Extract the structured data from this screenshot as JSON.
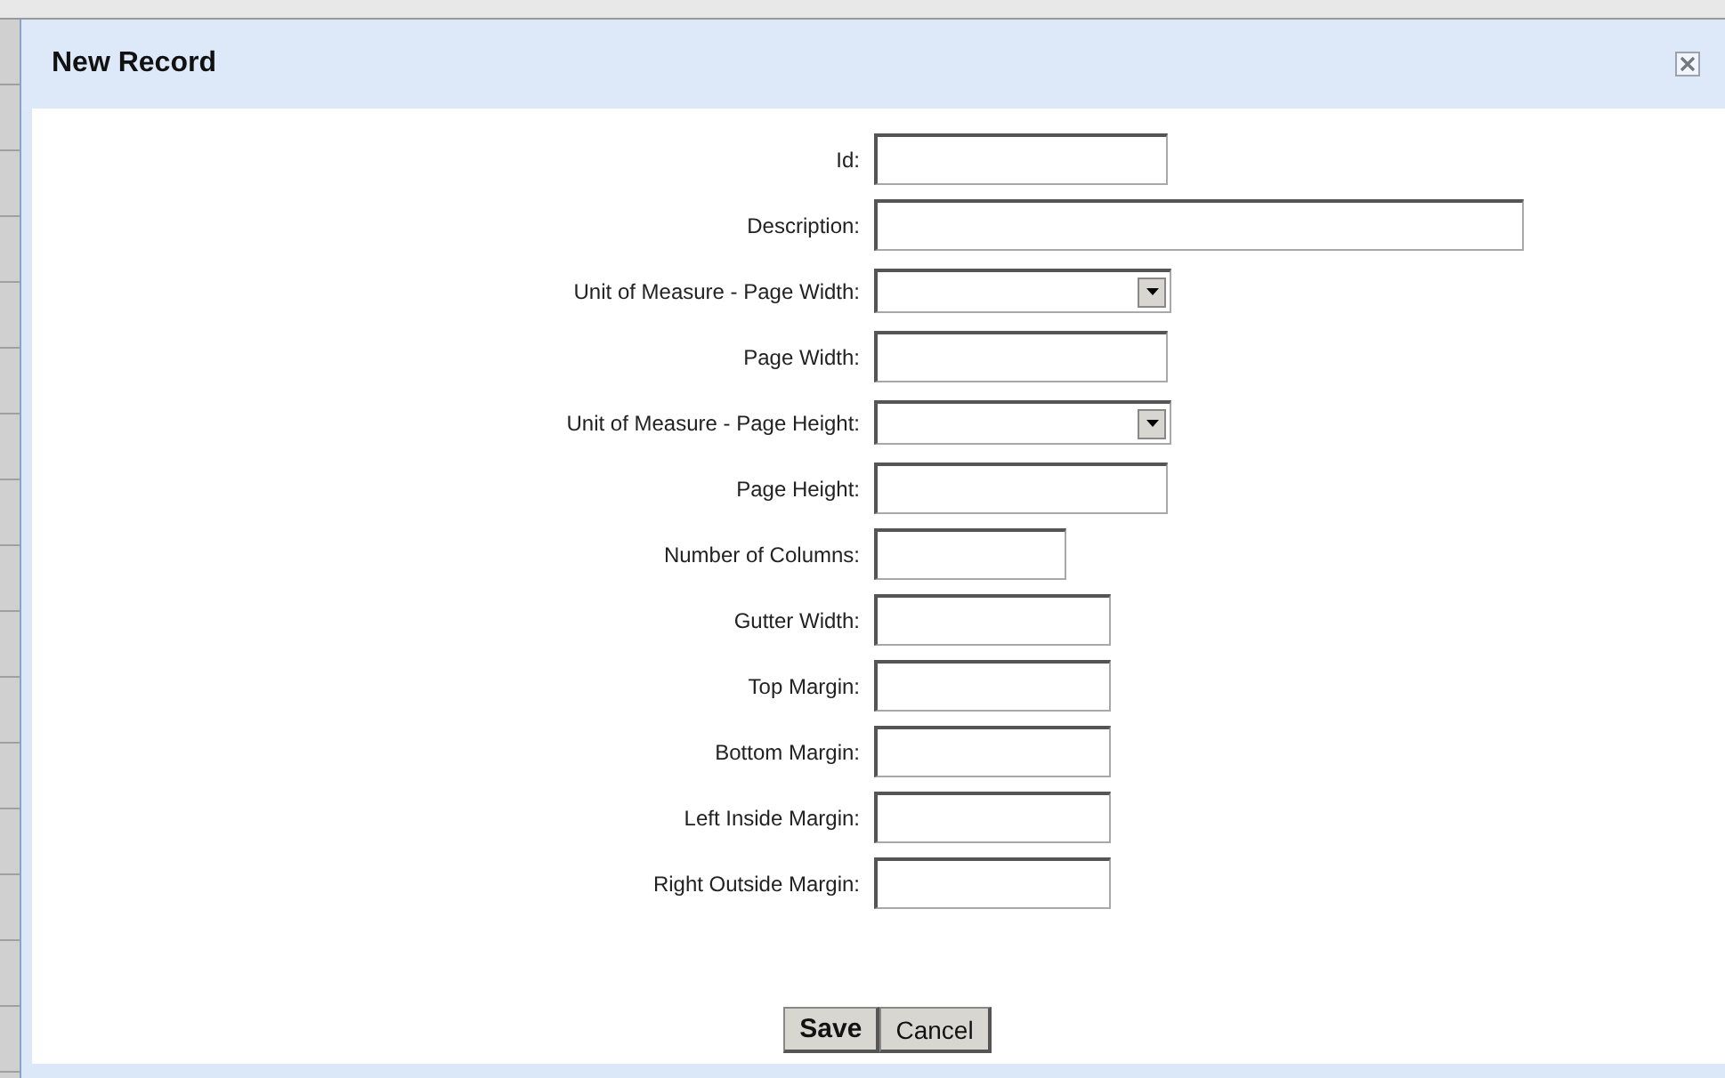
{
  "dialog": {
    "title": "New Record",
    "fields": [
      {
        "label": "Id:",
        "kind": "text"
      },
      {
        "label": "Description:",
        "kind": "text"
      },
      {
        "label": "Unit of Measure - Page Width:",
        "kind": "select"
      },
      {
        "label": "Page Width:",
        "kind": "text"
      },
      {
        "label": "Unit of Measure - Page Height:",
        "kind": "select"
      },
      {
        "label": "Page Height:",
        "kind": "text"
      },
      {
        "label": "Number of Columns:",
        "kind": "text"
      },
      {
        "label": "Gutter Width:",
        "kind": "text"
      },
      {
        "label": "Top Margin:",
        "kind": "text"
      },
      {
        "label": "Bottom Margin:",
        "kind": "text"
      },
      {
        "label": "Left Inside Margin:",
        "kind": "text"
      },
      {
        "label": "Right Outside Margin:",
        "kind": "text"
      }
    ],
    "buttons": [
      {
        "label": "Save",
        "kind": "primary"
      },
      {
        "label": "Cancel",
        "kind": "secondary"
      }
    ]
  }
}
